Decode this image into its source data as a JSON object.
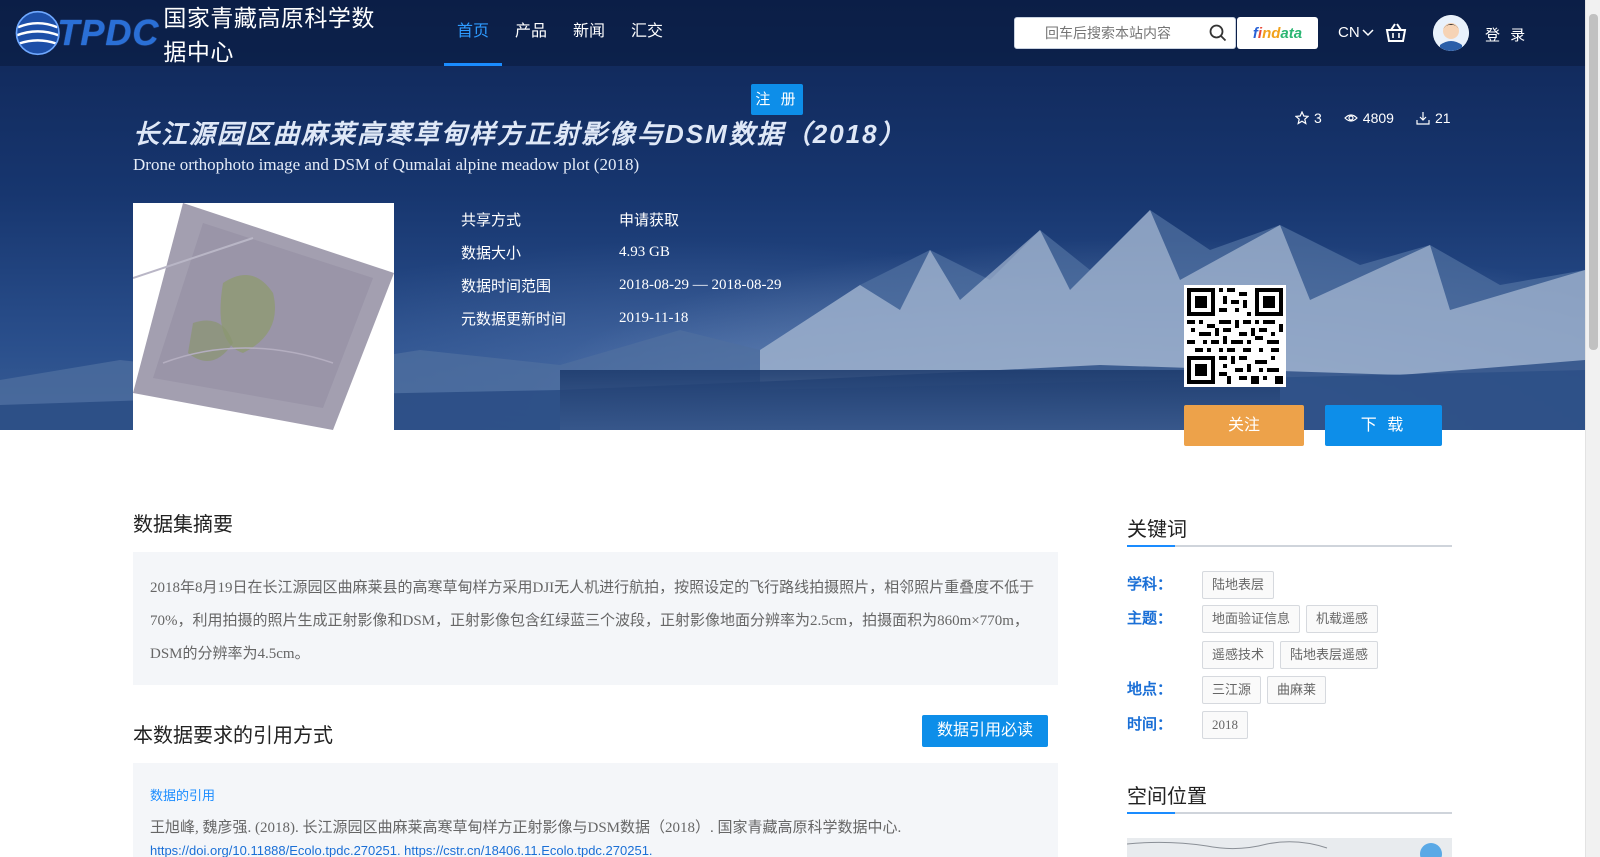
{
  "header": {
    "logo_text": "TPDC",
    "logo_cn": "国家青藏高原科学数据中心",
    "nav": [
      {
        "label": "首页"
      },
      {
        "label": "产品"
      },
      {
        "label": "新闻"
      },
      {
        "label": "汇交"
      }
    ],
    "search_placeholder": "回车后搜索本站内容",
    "findata": {
      "p1": "f",
      "p2": "i",
      "p3": "nd",
      "p4": "ata"
    },
    "lang": "CN",
    "login": "登 录",
    "register": "注 册"
  },
  "dataset": {
    "title_zh": "长江源园区曲麻莱高寒草甸样方正射影像与DSM数据（2018）",
    "title_en": "Drone orthophoto image and DSM of Qumalai alpine meadow plot (2018)",
    "stats": {
      "stars": "3",
      "views": "4809",
      "downloads": "21"
    },
    "meta": [
      {
        "key": "共享方式",
        "value": "申请获取"
      },
      {
        "key": "数据大小",
        "value": "4.93 GB"
      },
      {
        "key": "数据时间范围",
        "value": "2018-08-29 — 2018-08-29"
      },
      {
        "key": "元数据更新时间",
        "value": "2019-11-18"
      }
    ],
    "follow": "关注",
    "download": "下 载"
  },
  "main": {
    "abstract_title": "数据集摘要",
    "abstract_text": "2018年8月19日在长江源园区曲麻莱县的高寒草甸样方采用DJI无人机进行航拍，按照设定的飞行路线拍摄照片，相邻照片重叠度不低于70%，利用拍摄的照片生成正射影像和DSM，正射影像包含红绿蓝三个波段，正射影像地面分辨率为2.5cm，拍摄面积为860m×770m，DSM的分辨率为4.5cm。",
    "cite_title": "本数据要求的引用方式",
    "cite_button": "数据引用必读",
    "cite_label": "数据的引用",
    "cite_text": "王旭峰, 魏彦强. (2018). 长江源园区曲麻莱高寒草甸样方正射影像与DSM数据（2018）. 国家青藏高原科学数据中心.",
    "cite_link": "https://doi.org/10.11888/Ecolo.tpdc.270251. https://cstr.cn/18406.11.Ecolo.tpdc.270251."
  },
  "side": {
    "keywords_title": "关键词",
    "rows": [
      {
        "label": "学科：",
        "tags": [
          "陆地表层"
        ]
      },
      {
        "label": "主题：",
        "tags": [
          "地面验证信息",
          "机载遥感",
          "遥感技术",
          "陆地表层遥感"
        ]
      },
      {
        "label": "地点：",
        "tags": [
          "三江源",
          "曲麻莱"
        ]
      },
      {
        "label": "时间：",
        "tags": [
          "2018"
        ]
      }
    ],
    "location_title": "空间位置"
  },
  "colors": {
    "accent": "#0d8ee9",
    "follow": "#eda24a",
    "nav_active": "#2e9bff"
  }
}
